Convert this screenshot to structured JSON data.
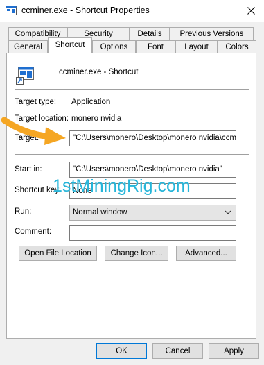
{
  "window": {
    "title": "ccminer.exe - Shortcut Properties"
  },
  "tabs_row1": [
    "Compatibility",
    "Security",
    "Details",
    "Previous Versions"
  ],
  "tabs_row2": [
    "General",
    "Shortcut",
    "Options",
    "Font",
    "Layout",
    "Colors"
  ],
  "active_tab": "Shortcut",
  "header": {
    "name": "ccminer.exe - Shortcut"
  },
  "fields": {
    "target_type_label": "Target type:",
    "target_type_value": "Application",
    "target_location_label": "Target location:",
    "target_location_value": "monero nvidia",
    "target_label": "Target:",
    "target_value": "\"C:\\Users\\monero\\Desktop\\monero nvidia\\ccmin",
    "start_in_label": "Start in:",
    "start_in_value": "\"C:\\Users\\monero\\Desktop\\monero nvidia\"",
    "shortcut_key_label": "Shortcut key:",
    "shortcut_key_value": "None",
    "run_label": "Run:",
    "run_value": "Normal window",
    "comment_label": "Comment:",
    "comment_value": ""
  },
  "buttons": {
    "open_file_location": "Open File Location",
    "change_icon": "Change Icon...",
    "advanced": "Advanced...",
    "ok": "OK",
    "cancel": "Cancel",
    "apply": "Apply"
  },
  "watermark": "1stMiningRig.com",
  "colors": {
    "watermark": "#26b5d9",
    "arrow": "#f5a623",
    "accent": "#0078d7"
  }
}
